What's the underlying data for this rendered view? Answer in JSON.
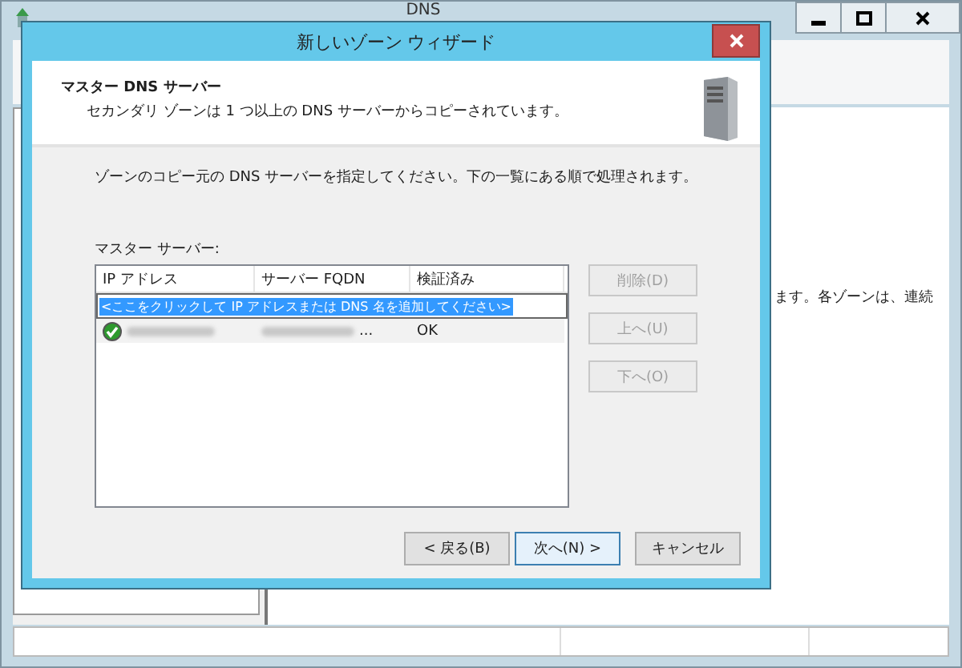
{
  "background_window": {
    "title": "DNS",
    "content_text": "ます。各ゾーンは、連続"
  },
  "dialog": {
    "title": "新しいゾーン ウィザード",
    "header": {
      "title": "マスター DNS サーバー",
      "subtitle": "セカンダリ ゾーンは 1 つ以上の DNS サーバーからコピーされています。"
    },
    "instruction": "ゾーンのコピー元の DNS サーバーを指定してください。下の一覧にある順で処理されます。",
    "list_label": "マスター サーバー:",
    "table": {
      "columns": [
        "IP アドレス",
        "サーバー FQDN",
        "検証済み"
      ],
      "add_row": {
        "text": "<ここをクリックして IP アドレスまたは DNS 名を追加してください>",
        "selected": true
      },
      "rows": [
        {
          "verified": "OK",
          "valid": true,
          "fqdn_suffix": "..."
        }
      ]
    },
    "side_buttons": [
      {
        "label": "削除(D)",
        "disabled": true
      },
      {
        "label": "上へ(U)",
        "disabled": true
      },
      {
        "label": "下へ(O)",
        "disabled": true
      }
    ],
    "nav_buttons": [
      {
        "label": "< 戻る(B)",
        "focused": false
      },
      {
        "label": "次へ(N) >",
        "focused": true
      },
      {
        "label": "キャンセル",
        "focused": false
      }
    ]
  }
}
